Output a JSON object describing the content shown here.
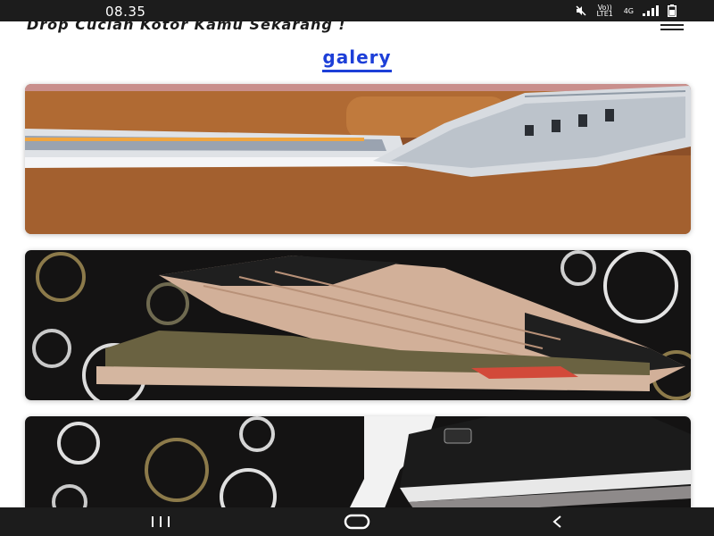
{
  "status_bar": {
    "time": "08.35",
    "signal_text": "Vo)) LTE1",
    "network_text": "4G"
  },
  "header": {
    "tagline": "Drop Cucian Kotor Kamu Sekarang !"
  },
  "gallery": {
    "title": "galery",
    "images": [
      {
        "name": "gallery-image-1",
        "subject": "white-grey-sneaker-on-sofa"
      },
      {
        "name": "gallery-image-2",
        "subject": "beige-sneaker-on-circle-pattern"
      },
      {
        "name": "gallery-image-3",
        "subject": "black-sneaker-on-circle-pattern"
      }
    ]
  },
  "colors": {
    "accent": "#1d3fd8",
    "status_bar": "#1c1c1c",
    "background": "#ffffff"
  },
  "icons": {
    "menu": "hamburger-icon",
    "nav_recent": "recent-apps-icon",
    "nav_home": "home-icon",
    "nav_back": "back-icon"
  }
}
